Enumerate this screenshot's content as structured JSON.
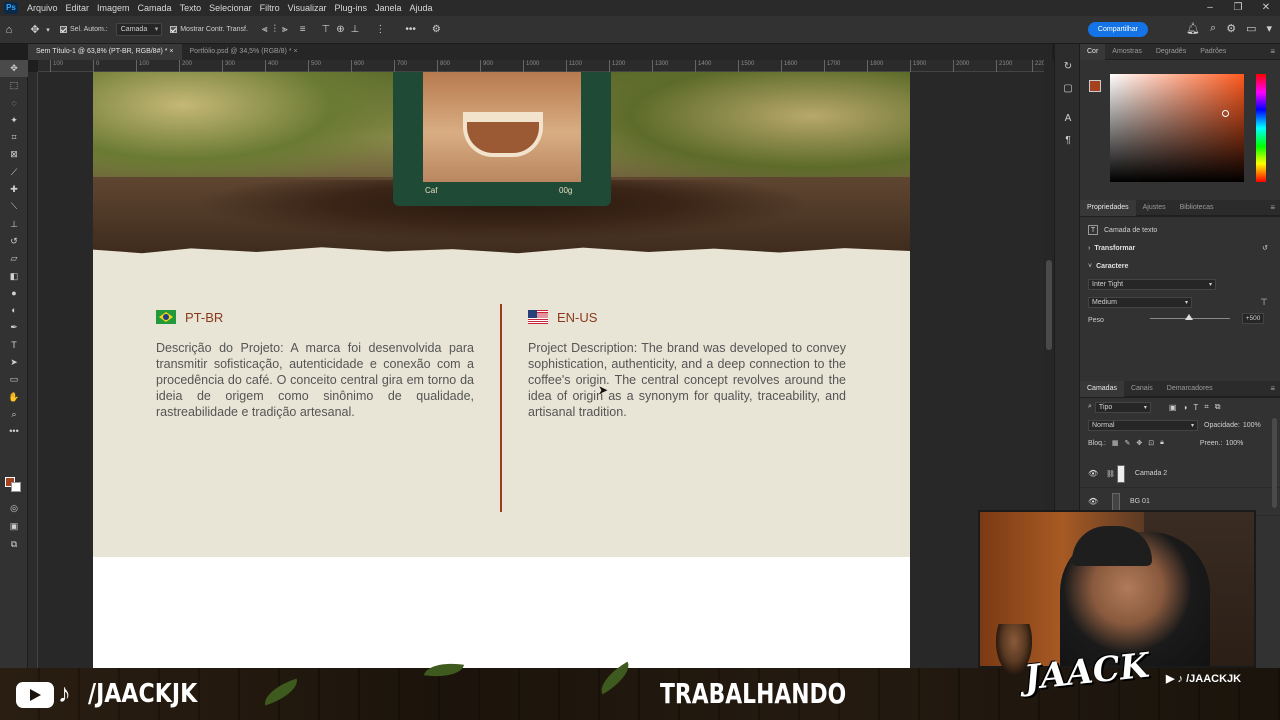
{
  "menubar": {
    "logo": "Ps",
    "items": [
      "Arquivo",
      "Editar",
      "Imagem",
      "Camada",
      "Texto",
      "Selecionar",
      "Filtro",
      "Visualizar",
      "Plug-ins",
      "Janela",
      "Ajuda"
    ]
  },
  "options": {
    "auto_select_label": "Sel. Autom.:",
    "auto_select_target": "Camada",
    "show_transform_label": "Mostrar Contr. Transf.",
    "share_label": "Compartilhar"
  },
  "tabs": [
    {
      "label": "Sem Título-1 @ 63,8% (PT-BR, RGB/8#) *",
      "close": "×"
    },
    {
      "label": "Portfólio.psd @ 34,5% (RGB/8) *",
      "close": "×"
    }
  ],
  "ruler": [
    "100",
    "0",
    "100",
    "200",
    "300",
    "400",
    "500",
    "600",
    "700",
    "800",
    "900",
    "1000",
    "1100",
    "1200",
    "1300",
    "1400",
    "1500",
    "1600",
    "1700",
    "1800",
    "1900",
    "2000",
    "2100",
    "220"
  ],
  "document": {
    "bag_brand": "Caf",
    "bag_weight": "00g",
    "left": {
      "lang": "PT-BR",
      "text": "Descrição do Projeto: A marca foi desenvolvida para transmitir sofisticação, autenticidade e conexão com a procedência do café. O conceito central gira em torno da ideia de origem como sinônimo de qualidade, rastreabilidade e tradição artesanal."
    },
    "right": {
      "lang": "EN-US",
      "text": "Project Description: The brand was developed to convey sophistication, authenticity, and a deep connection to the coffee's origin. The central concept revolves around the idea of origin as a synonym for quality, traceability, and artisanal tradition."
    }
  },
  "color_panel": {
    "tabs": [
      "Cor",
      "Amostras",
      "Degradês",
      "Padrões"
    ],
    "foreground": "#a4411f",
    "background": "#ffffff"
  },
  "properties": {
    "tabs": [
      "Propriedades",
      "Ajustes",
      "Bibliotecas"
    ],
    "layer_type": "Camada de texto",
    "transform": "Transformar",
    "character": "Caractere",
    "font": "Inter Tight",
    "weight_style": "Medium",
    "weight_label": "Peso",
    "weight_value": "+500"
  },
  "layers": {
    "tabs": [
      "Camadas",
      "Canais",
      "Demarcadores"
    ],
    "filter": "Tipo",
    "blend": "Normal",
    "opacity_label": "Opacidade:",
    "opacity_value": "100%",
    "lock_label": "Bloq.:",
    "fill_label": "Preen.:",
    "fill_value": "100%",
    "items": [
      {
        "name": "Camada 2"
      },
      {
        "name": "BG 01"
      }
    ]
  },
  "stream": {
    "handle": "/JAACKJK",
    "status": "TRABALHANDO",
    "brand": "JAACK",
    "handle_small": "/JAACKJK"
  }
}
